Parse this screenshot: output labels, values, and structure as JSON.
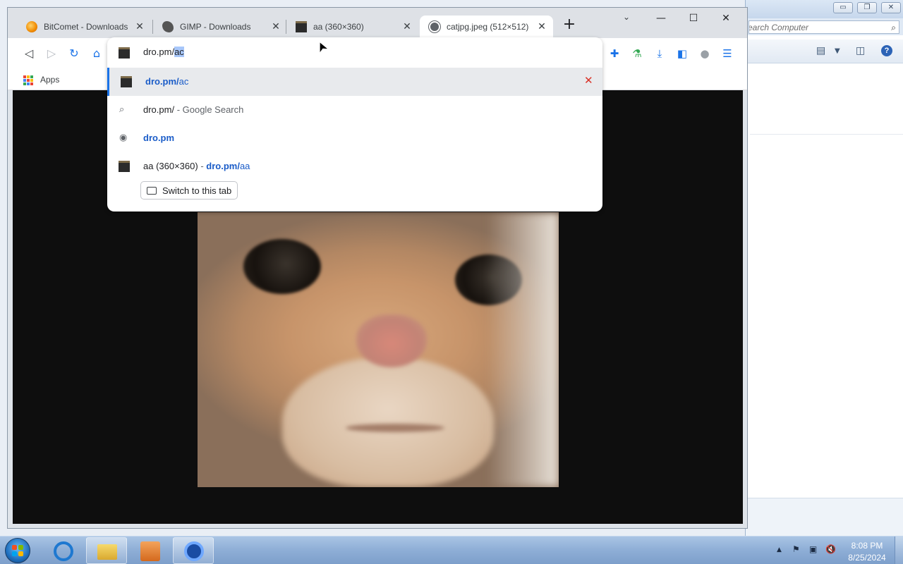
{
  "background_window": {
    "search_placeholder": "Search Computer",
    "search_icon": "search-icon",
    "minimize": "▭",
    "restore": "❐",
    "close": "✕"
  },
  "browser": {
    "tabs": [
      {
        "title": "BitComet - Downloads",
        "favicon": "bitcomet-icon",
        "active": false
      },
      {
        "title": "GIMP - Downloads",
        "favicon": "gimp-icon",
        "active": false
      },
      {
        "title": "aa (360×360)",
        "favicon": "image-icon",
        "active": false
      },
      {
        "title": "catjpg.jpeg (512×512)",
        "favicon": "globe-icon",
        "active": true
      }
    ],
    "tab_close_glyph": "✕",
    "new_tab_glyph": "+",
    "tab_search_glyph": "⌄",
    "window_controls": {
      "minimize": "—",
      "maximize": "☐",
      "close": "✕"
    },
    "nav": {
      "back": "◁",
      "forward": "▷",
      "reload": "↻",
      "home": "⌂"
    },
    "toolbar_icons": {
      "extensions": "✚",
      "lab": "⚗",
      "download": "⤓",
      "side_panel": "◧",
      "profile": "●",
      "menu": "☰"
    },
    "bookmarks": {
      "apps_label": "Apps",
      "apps_colors": [
        "#ea4335",
        "#fbbc05",
        "#34a853",
        "#4285f4",
        "#ea4335",
        "#fbbc05",
        "#34a853",
        "#4285f4",
        "#ea4335"
      ]
    },
    "omnibox": {
      "typed": "dro.pm/",
      "autocomplete": "ac",
      "suggestions": [
        {
          "type": "history",
          "url_bold": "dro.pm/",
          "url_rest": "ac",
          "removable": true,
          "remove_glyph": "✕"
        },
        {
          "type": "search",
          "icon": "🔍",
          "text": "dro.pm/",
          "suffix": " - Google Search"
        },
        {
          "type": "site",
          "icon": "◉",
          "url_bold": "dro.pm"
        },
        {
          "type": "open-tab",
          "title": "aa (360×360)",
          "sep": " - ",
          "url_bold": "dro.pm/",
          "url_rest": "aa"
        }
      ],
      "switch_tab_label": "Switch to this tab"
    },
    "content": {
      "image": "blurry orange cat close-up",
      "background": "#0e0e0e"
    }
  },
  "taskbar": {
    "start_colors": [
      "#f25022",
      "#7fba00",
      "#00a4ef",
      "#ffb900"
    ],
    "pinned": [
      "internet-explorer-icon",
      "file-explorer-icon",
      "media-player-icon",
      "chrome-icon"
    ],
    "tray_icons": {
      "arrow": "▲",
      "flag": "⚑",
      "network": "▣",
      "volume": "🔇"
    },
    "time": "8:08 PM",
    "date": "8/25/2024"
  },
  "cursor": "➤"
}
